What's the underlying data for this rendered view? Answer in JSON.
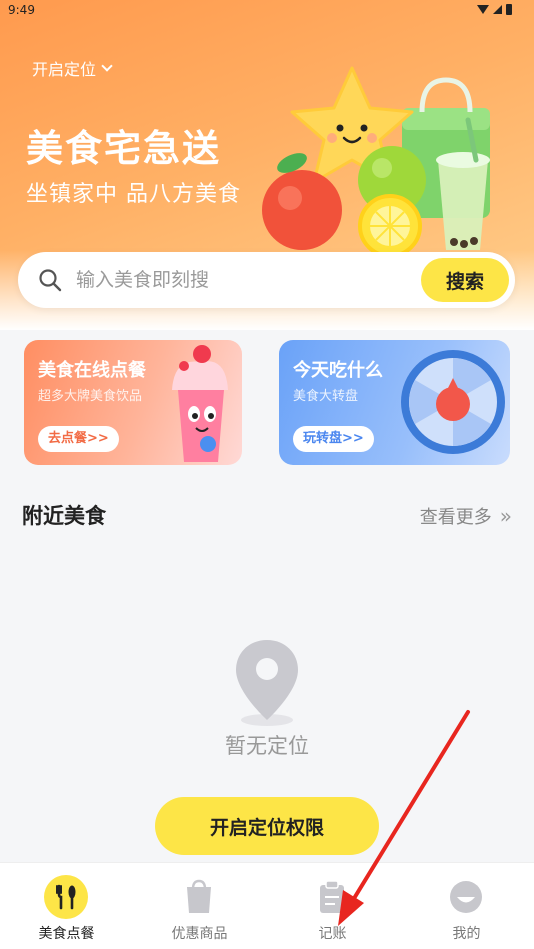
{
  "status_bar": {
    "time": "9:49"
  },
  "header": {
    "location_toggle": "开启定位"
  },
  "hero": {
    "title": "美食宅急送",
    "subtitle": "坐镇家中 品八方美食"
  },
  "search": {
    "placeholder": "输入美食即刻搜",
    "button_label": "搜索"
  },
  "promos": [
    {
      "title": "美食在线点餐",
      "subtitle": "超多大牌美食饮品",
      "button_label": "去点餐>>",
      "icon": "frappe-cup-mascot"
    },
    {
      "title": "今天吃什么",
      "subtitle": "美食大转盘",
      "button_label": "玩转盘>>",
      "icon": "spinning-wheel"
    }
  ],
  "nearby": {
    "title": "附近美食",
    "see_more": "查看更多",
    "empty_text": "暂无定位",
    "enable_button": "开启定位权限"
  },
  "tabs": [
    {
      "label": "美食点餐",
      "icon": "fork-knife-icon",
      "active": true
    },
    {
      "label": "优惠商品",
      "icon": "shopping-bag-icon",
      "active": false
    },
    {
      "label": "记账",
      "icon": "clipboard-icon",
      "active": false
    },
    {
      "label": "我的",
      "icon": "smiley-icon",
      "active": false
    }
  ],
  "colors": {
    "accent_yellow": "#fde547",
    "hero_orange": "#ff9a4e",
    "promo_blue": "#6aa2f8",
    "annotation_red": "#e8261f"
  }
}
